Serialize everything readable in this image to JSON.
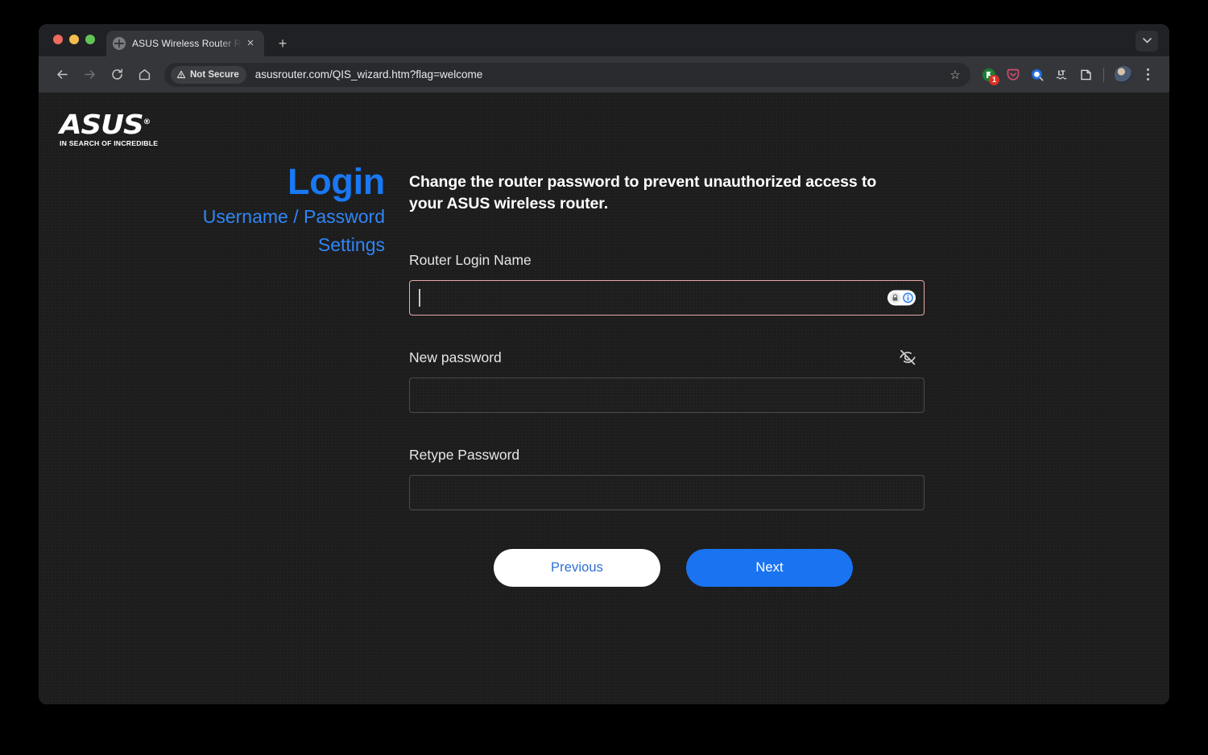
{
  "browser": {
    "tab": {
      "title": "ASUS Wireless Router RT-BE",
      "close_label": "×",
      "favicon": "globe-icon"
    },
    "new_tab_label": "+",
    "tab_list_label": "⌄",
    "nav": {
      "back": "back-arrow-icon",
      "forward": "forward-arrow-icon",
      "reload": "reload-icon",
      "home": "home-icon"
    },
    "omnibox": {
      "security_label": "Not Secure",
      "url": "asusrouter.com/QIS_wizard.htm?flag=welcome",
      "bookmark_label": "☆"
    },
    "extensions": [
      {
        "name": "extension-green",
        "badge": "1"
      },
      {
        "name": "pocket-extension",
        "badge": ""
      },
      {
        "name": "blue-circle-extension",
        "badge": ""
      },
      {
        "name": "languagetool-extension",
        "badge": ""
      },
      {
        "name": "clipboard-extension",
        "badge": ""
      }
    ],
    "profile_label": "profile-avatar",
    "menu_label": "chrome-menu"
  },
  "page": {
    "brand": {
      "name": "ASUS",
      "trademark": "®",
      "tagline": "IN SEARCH OF INCREDIBLE"
    },
    "heading": {
      "title": "Login",
      "subtitle_line1": "Username / Password",
      "subtitle_line2": "Settings"
    },
    "lead": "Change the router password to prevent unauthorized access to your ASUS wireless router.",
    "fields": [
      {
        "label": "Router Login Name",
        "value": "",
        "placeholder": "",
        "focused": true,
        "has_password_manager_badge": true,
        "has_eye_toggle": false
      },
      {
        "label": "New password",
        "value": "",
        "placeholder": "",
        "focused": false,
        "has_password_manager_badge": false,
        "has_eye_toggle": true
      },
      {
        "label": "Retype Password",
        "value": "",
        "placeholder": "",
        "focused": false,
        "has_password_manager_badge": false,
        "has_eye_toggle": false
      }
    ],
    "buttons": {
      "previous": "Previous",
      "next": "Next"
    },
    "colors": {
      "accent_blue": "#1978f3",
      "button_blue": "#1a73f0",
      "focus_border": "#e8a8a8",
      "page_bg": "#1c1c1c"
    }
  }
}
